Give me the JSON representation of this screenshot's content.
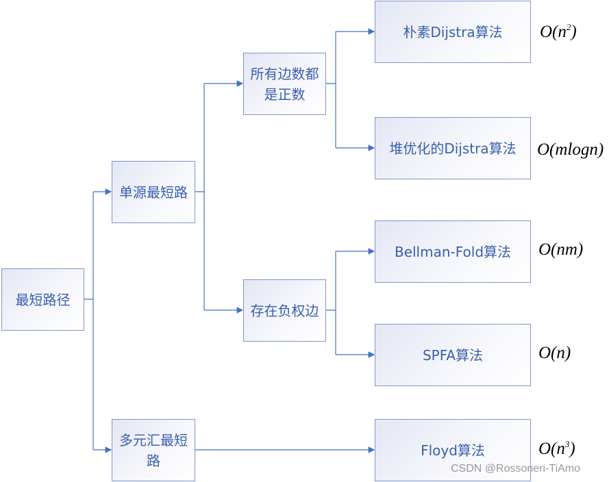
{
  "nodes": {
    "root": "最短路径",
    "single_source": "单源最短路",
    "multi_source": "多元汇最短路",
    "all_positive": "所有边数都是正数",
    "negative_edges": "存在负权边",
    "naive_dijkstra": "朴素Dijstra算法",
    "heap_dijkstra": "堆优化的Dijstra算法",
    "bellman_ford": "Bellman-Fold算法",
    "spfa": "SPFA算法",
    "floyd": "Floyd算法"
  },
  "complexities": {
    "naive_dijkstra": {
      "base": "O(n",
      "exp": "2",
      "end": ")"
    },
    "heap_dijkstra": "O(mlogn)",
    "bellman_ford": "O(nm)",
    "spfa": "O(n)",
    "floyd": {
      "base": "O(n",
      "exp": "3",
      "end": ")"
    }
  },
  "colors": {
    "line": "#4472c4",
    "text": "#3a5fb0",
    "border": "#7f96c9"
  },
  "watermark": "CSDN @Rossoneri-TiAmo"
}
